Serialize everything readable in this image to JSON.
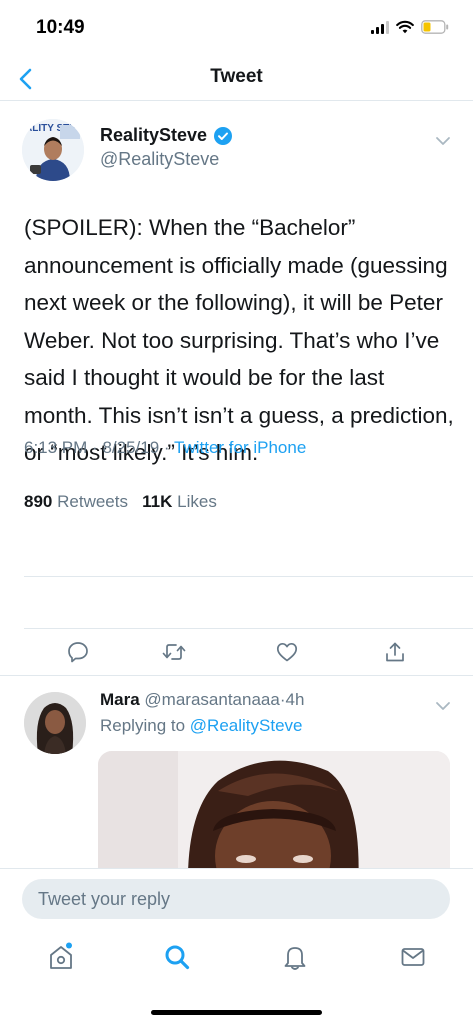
{
  "status_bar": {
    "time": "10:49"
  },
  "nav": {
    "title": "Tweet"
  },
  "tweet": {
    "author_name": "RealitySteve",
    "author_handle": "@RealitySteve",
    "avatar_text": "ALITY STE",
    "text": "(SPOILER): When the “Bachelor” announcement is officially made (guessing next week or the following), it will be Peter Weber. Not too surprising. That’s who I’ve said I thought it would be for the last month. This isn’t isn’t a guess, a prediction, or “most likely.” It’s him.",
    "time": "6:13 PM",
    "date": "8/25/19",
    "source": "Twitter for iPhone",
    "retweets_count": "890",
    "retweets_label": "Retweets",
    "likes_count": "11K",
    "likes_label": "Likes"
  },
  "reply": {
    "name": "Mara",
    "handle": "@marasantanaaa",
    "age": "4h",
    "replying_prefix": "Replying to",
    "replying_to": "@RealitySteve"
  },
  "compose": {
    "placeholder": "Tweet your reply"
  },
  "colors": {
    "accent": "#1da1f2",
    "secondary_text": "#657786",
    "divider": "#e1e8ed"
  },
  "icons": [
    "back-icon",
    "verified-badge-icon",
    "chevron-down-icon",
    "reply-icon",
    "retweet-icon",
    "like-icon",
    "share-icon",
    "home-icon",
    "search-icon",
    "notifications-icon",
    "messages-icon"
  ]
}
